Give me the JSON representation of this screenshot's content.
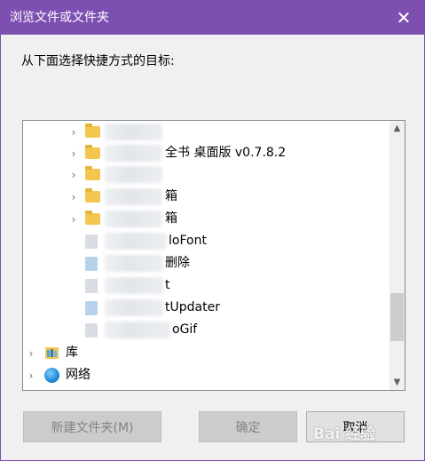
{
  "dialog": {
    "title": "浏览文件或文件夹",
    "close_symbol": "✕",
    "instruction": "从下面选择快捷方式的目标:"
  },
  "tree": {
    "rows": [
      {
        "kind": "folder",
        "label": "",
        "expandable": true
      },
      {
        "kind": "folder",
        "label": "全书 桌面版 v0.7.8.2",
        "expandable": true
      },
      {
        "kind": "folder",
        "label": "",
        "expandable": true
      },
      {
        "kind": "folder",
        "label": "箱",
        "expandable": true
      },
      {
        "kind": "folder",
        "label": "箱",
        "expandable": true
      },
      {
        "kind": "file",
        "label": "loFont",
        "expandable": false
      },
      {
        "kind": "file",
        "label": "删除",
        "expandable": false
      },
      {
        "kind": "file",
        "label": "t",
        "expandable": false
      },
      {
        "kind": "file",
        "label": "tUpdater",
        "expandable": false
      },
      {
        "kind": "file",
        "label": "oGif",
        "expandable": false
      }
    ],
    "library_label": "库",
    "network_label": "网络"
  },
  "buttons": {
    "new_folder": "新建文件夹(M)",
    "ok": "确定",
    "cancel": "取消"
  },
  "watermark": "Bai 经验",
  "colors": {
    "titlebar": "#7d4fb0",
    "folder": "#f4c64d",
    "scroll_thumb": "#cdcdcd"
  }
}
